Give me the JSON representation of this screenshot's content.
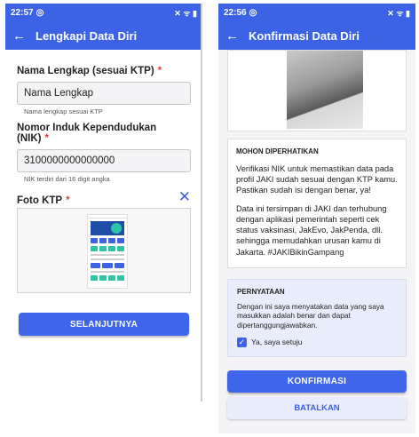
{
  "screen1": {
    "status": {
      "time": "22:57",
      "icons": "✕ ᯤ ▮"
    },
    "appbar": {
      "back_icon": "←",
      "title": "Lengkapi Data Diri"
    },
    "name_field": {
      "label": "Nama Lengkap (sesuai KTP)",
      "required_mark": "*",
      "value": "Nama Lengkap",
      "helper": "Nama lengkap sesuai KTP"
    },
    "nik_field": {
      "label": "Nomor Induk Kependudukan (NIK)",
      "required_mark": "*",
      "value": "3100000000000000",
      "helper": "NIK terdiri dari 16 digit angka"
    },
    "photo_field": {
      "label": "Foto KTP",
      "required_mark": "*",
      "close_icon": "✕"
    },
    "next_button": "SELANJUTNYA"
  },
  "screen2": {
    "status": {
      "time": "22:56",
      "icons": "✕ ᯤ ▮"
    },
    "appbar": {
      "back_icon": "←",
      "title": "Konfirmasi Data Diri"
    },
    "notice": {
      "title": "MOHON DIPERHATIKAN",
      "p1": "Verifikasi NIK untuk memastikan data pada profil JAKI sudah sesuai dengan KTP kamu. Pastikan sudah isi dengan benar, ya!",
      "p2": "Data ini tersimpan di JAKI dan terhubung dengan aplikasi pemerintah seperti cek status vaksinasi, JakEvo, JakPenda, dll. sehingga memudahkan urusan kamu di Jakarta. #JAKIBikinGampang"
    },
    "statement": {
      "title": "PERNYATAAN",
      "text": "Dengan ini saya menyatakan data yang saya masukkan adalah benar dan dapat dipertanggungjawabkan.",
      "checkbox_label": "Ya, saya setuju",
      "checked": true
    },
    "confirm_button": "KONFIRMASI",
    "cancel_button": "BATALKAN"
  },
  "colors": {
    "primary": "#3c62e6",
    "required": "#e53935",
    "statement_bg": "#e9ecfb"
  }
}
